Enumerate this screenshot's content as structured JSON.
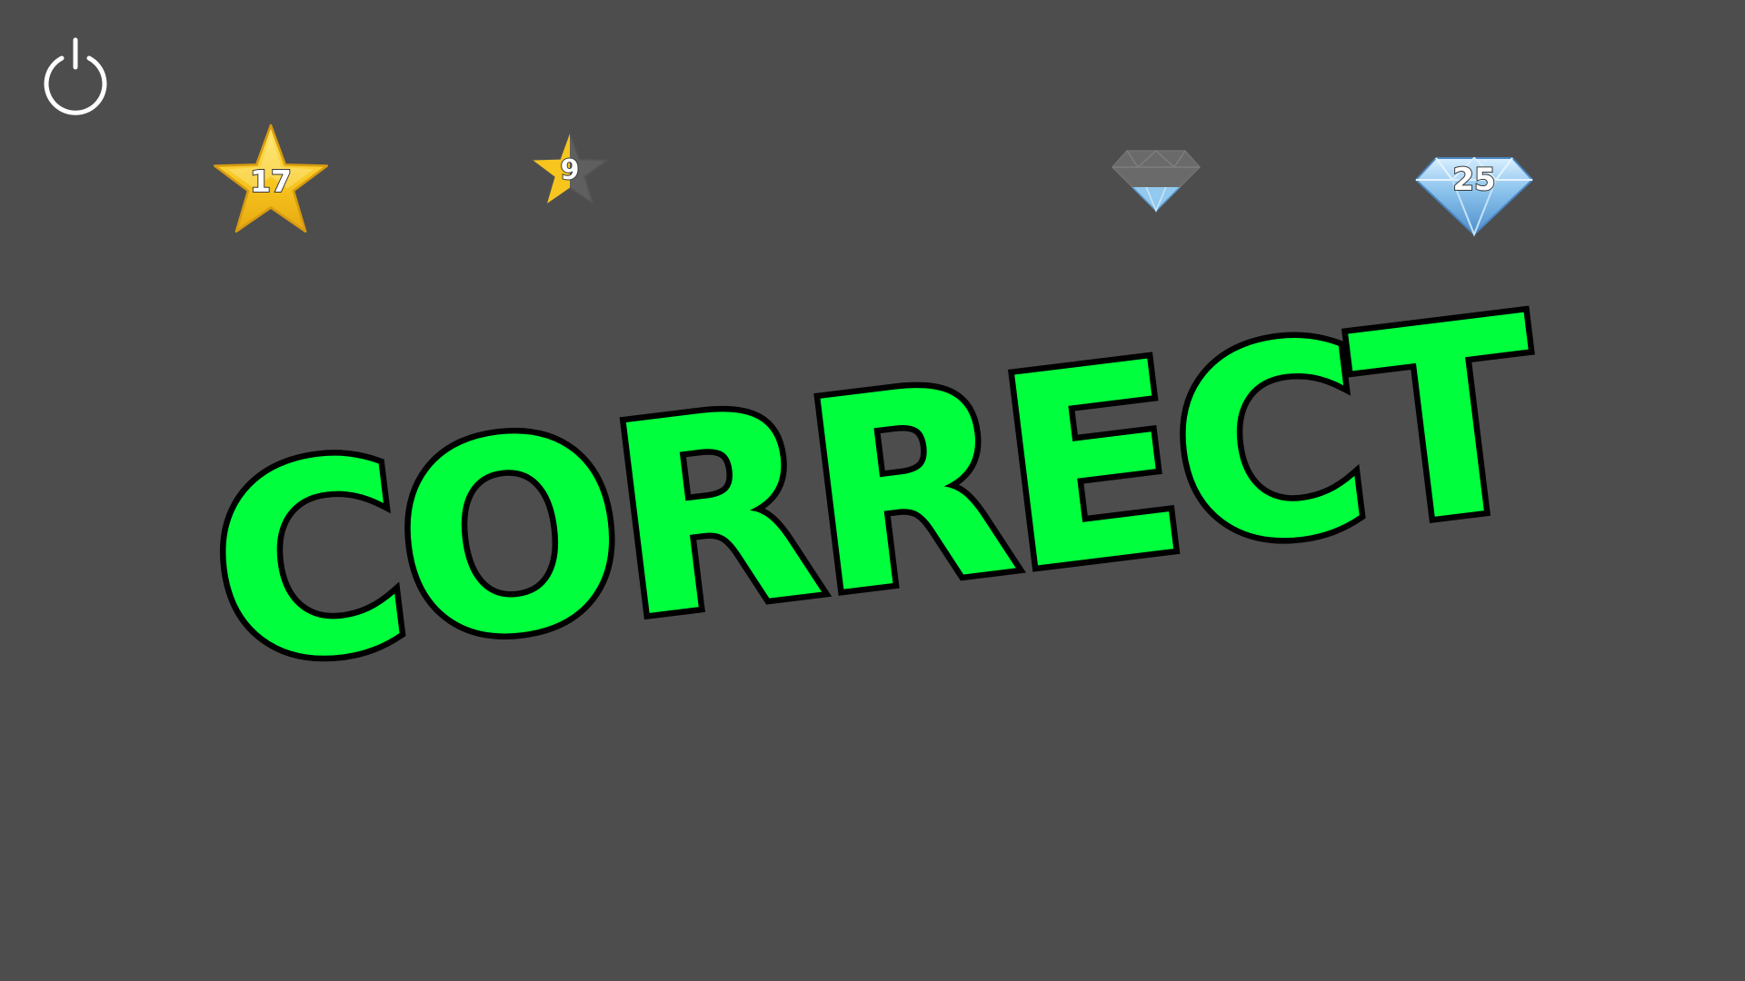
{
  "hud": {
    "power_icon": "power-icon",
    "stars_total": {
      "icon": "star-icon",
      "value": "17"
    },
    "stars_progress": {
      "icon": "half-star-icon",
      "value": "9",
      "fill_fraction": 0.5
    },
    "gems_progress": {
      "icon": "diamond-icon",
      "fill_fraction": 0.3
    },
    "gems_total": {
      "icon": "diamond-icon",
      "value": "25"
    }
  },
  "banner": {
    "text": "CORRECT",
    "color": "#00ff3c",
    "outline_color": "#000000"
  },
  "colors": {
    "background": "#4d4d4d",
    "star_gold": "#f7c21d",
    "star_grey": "#5f5f5f",
    "diamond_blue": "#8fc6ee"
  }
}
